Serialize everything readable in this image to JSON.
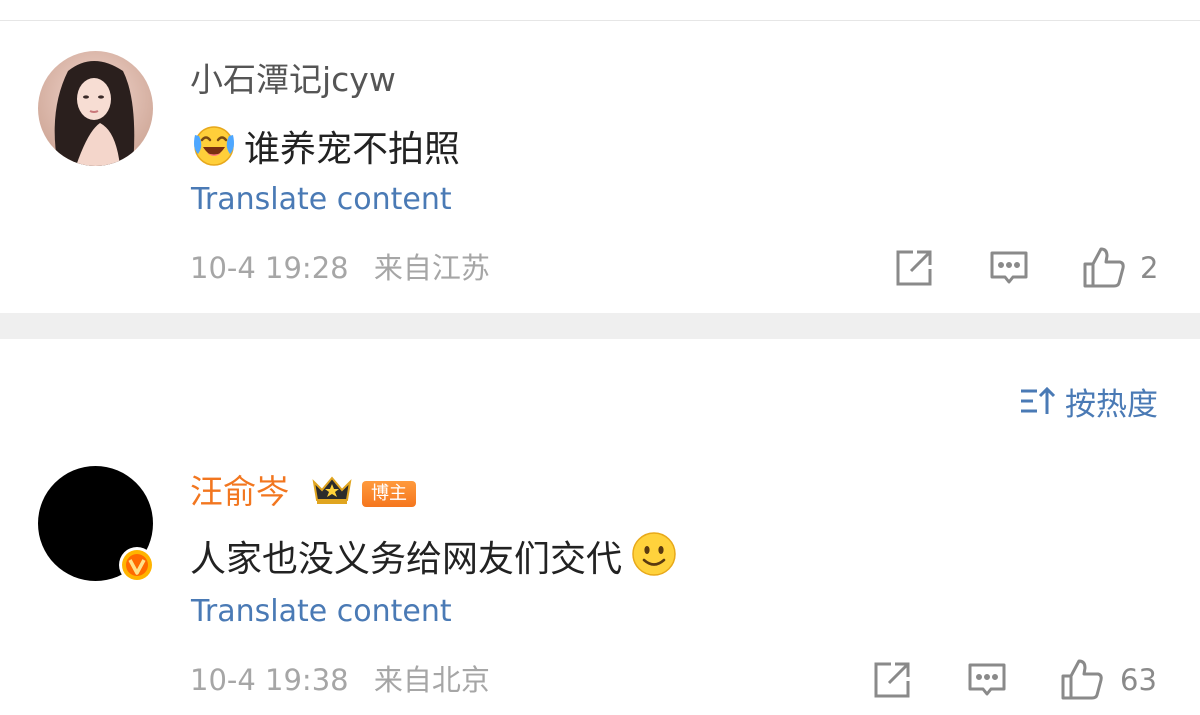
{
  "comments": [
    {
      "username": "小石潭记jcyw",
      "text": "谁养宠不拍照",
      "emoji": "laughing-crying-emoji",
      "translate_label": "Translate content",
      "time": "10-4 19:28",
      "location": "来自江苏",
      "likes": "2"
    },
    {
      "username": "汪俞岑",
      "badge": "博主",
      "text": "人家也没义务给网友们交代",
      "emoji": "smile-emoji",
      "translate_label": "Translate content",
      "time": "10-4 19:38",
      "location": "来自北京",
      "likes": "63"
    }
  ],
  "sort": {
    "label": "按热度",
    "icon": "sort-icon"
  },
  "colors": {
    "accent_blue": "#4a7ab5",
    "username_orange": "#f2761f",
    "meta_gray": "#a6a6a6",
    "divider": "#efefef"
  }
}
